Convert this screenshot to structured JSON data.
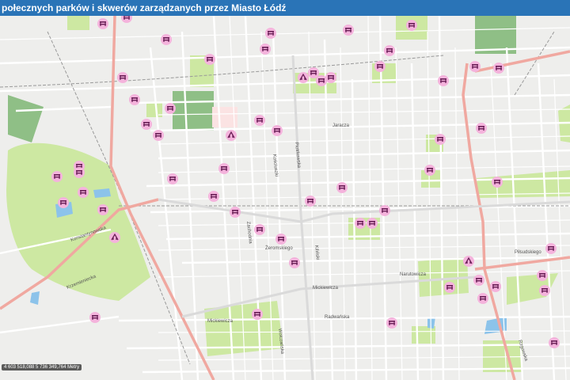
{
  "title": "połecznych parków i skwerów zarządzanych przez Miasto Łódź",
  "coordinates": "4 603 518,088 5 736 349,764 Metry",
  "colors": {
    "title_bar": "#2a74b7",
    "background": "#eeeeec",
    "park": "#cde8a2",
    "forest": "#8fbf86",
    "water": "#8cc3ea",
    "main_road": "#f0a8a0",
    "road": "#ffffff",
    "marker": "#f4b3dc"
  },
  "street_labels": [
    "Kiliński",
    "Piotrkowska",
    "Mickiewicza",
    "Mickiewicza",
    "Piłsudskiego",
    "Konstantynowska",
    "Krzemieniecka",
    "Kościuszki",
    "Zachodnia",
    "Wólczańska",
    "Żeromskiego",
    "Radwańska",
    "Rzgowska",
    "Narutowicza",
    "Jaracza"
  ],
  "markers": [
    {
      "icon": "park-bench-icon"
    },
    {
      "icon": "park-bench-icon"
    },
    {
      "icon": "park-bench-icon"
    },
    {
      "icon": "park-bench-icon"
    },
    {
      "icon": "park-bench-icon"
    },
    {
      "icon": "park-bench-icon"
    },
    {
      "icon": "playground-icon"
    },
    {
      "icon": "park-bench-icon"
    },
    {
      "icon": "park-bench-icon"
    },
    {
      "icon": "park-bench-icon"
    },
    {
      "icon": "park-bench-icon"
    },
    {
      "icon": "park-bench-icon"
    },
    {
      "icon": "park-bench-icon"
    },
    {
      "icon": "park-bench-icon"
    },
    {
      "icon": "park-bench-icon"
    },
    {
      "icon": "park-bench-icon"
    },
    {
      "icon": "park-bench-icon"
    },
    {
      "icon": "park-bench-icon"
    },
    {
      "icon": "park-bench-icon"
    },
    {
      "icon": "park-bench-icon"
    },
    {
      "icon": "park-bench-icon"
    },
    {
      "icon": "park-bench-icon"
    },
    {
      "icon": "park-bench-icon"
    },
    {
      "icon": "park-bench-icon"
    },
    {
      "icon": "playground-icon"
    },
    {
      "icon": "park-bench-icon"
    },
    {
      "icon": "park-bench-icon"
    },
    {
      "icon": "park-bench-icon"
    },
    {
      "icon": "park-bench-icon"
    },
    {
      "icon": "park-bench-icon"
    },
    {
      "icon": "park-bench-icon"
    },
    {
      "icon": "park-bench-icon"
    },
    {
      "icon": "park-bench-icon"
    },
    {
      "icon": "park-bench-icon"
    },
    {
      "icon": "park-bench-icon"
    },
    {
      "icon": "park-bench-icon"
    },
    {
      "icon": "park-bench-icon"
    },
    {
      "icon": "park-bench-icon"
    },
    {
      "icon": "park-bench-icon"
    },
    {
      "icon": "park-bench-icon"
    },
    {
      "icon": "park-bench-icon"
    },
    {
      "icon": "park-bench-icon"
    },
    {
      "icon": "playground-icon"
    },
    {
      "icon": "park-bench-icon"
    },
    {
      "icon": "park-bench-icon"
    },
    {
      "icon": "park-bench-icon"
    },
    {
      "icon": "park-bench-icon"
    },
    {
      "icon": "park-bench-icon"
    }
  ]
}
